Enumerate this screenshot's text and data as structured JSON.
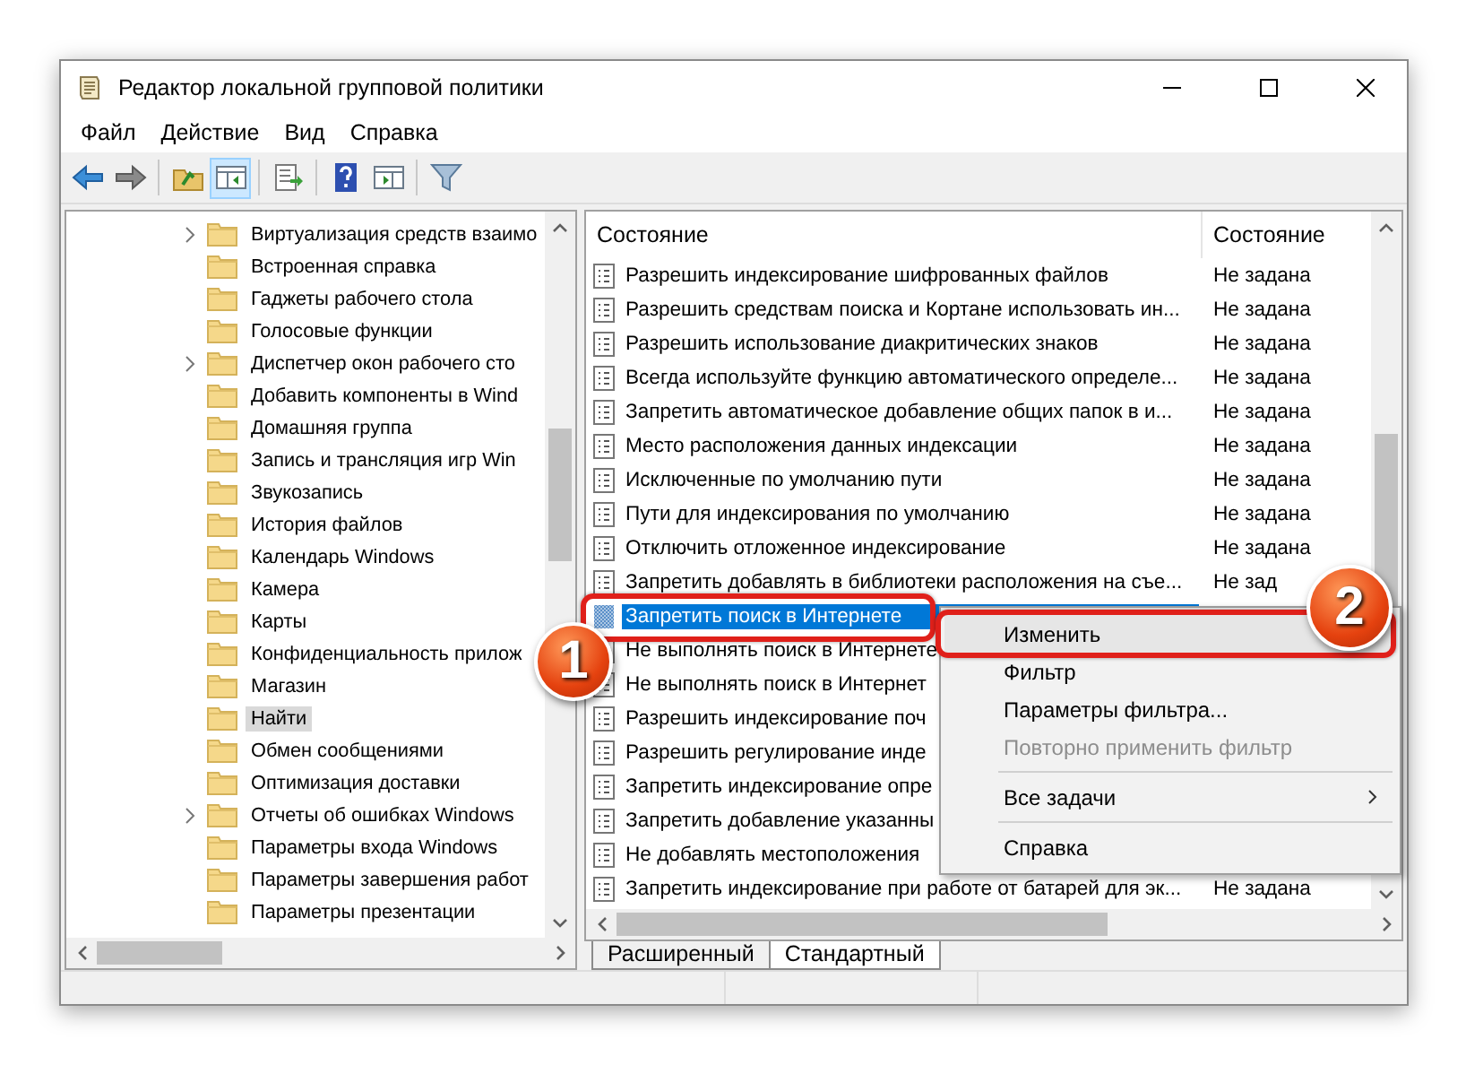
{
  "window": {
    "title": "Редактор локальной групповой политики"
  },
  "menu": [
    "Файл",
    "Действие",
    "Вид",
    "Справка"
  ],
  "toolbar": [
    {
      "kind": "back",
      "pressed": false
    },
    {
      "kind": "forward",
      "pressed": false
    },
    {
      "kind": "sep"
    },
    {
      "kind": "up",
      "pressed": false
    },
    {
      "kind": "tree",
      "pressed": true
    },
    {
      "kind": "sep"
    },
    {
      "kind": "export",
      "pressed": false
    },
    {
      "kind": "sep"
    },
    {
      "kind": "help",
      "pressed": false
    },
    {
      "kind": "pane",
      "pressed": false
    },
    {
      "kind": "sep"
    },
    {
      "kind": "filter",
      "pressed": false
    }
  ],
  "tree": {
    "items": [
      {
        "label": "Виртуализация средств взаимо",
        "expandable": true,
        "selected": false
      },
      {
        "label": "Встроенная справка",
        "expandable": false,
        "selected": false
      },
      {
        "label": "Гаджеты рабочего стола",
        "expandable": false,
        "selected": false
      },
      {
        "label": "Голосовые функции",
        "expandable": false,
        "selected": false
      },
      {
        "label": "Диспетчер окон рабочего сто",
        "expandable": true,
        "selected": false
      },
      {
        "label": "Добавить компоненты в Wind",
        "expandable": false,
        "selected": false
      },
      {
        "label": "Домашняя группа",
        "expandable": false,
        "selected": false
      },
      {
        "label": "Запись и трансляция игр Win",
        "expandable": false,
        "selected": false
      },
      {
        "label": "Звукозапись",
        "expandable": false,
        "selected": false
      },
      {
        "label": "История файлов",
        "expandable": false,
        "selected": false
      },
      {
        "label": "Календарь Windows",
        "expandable": false,
        "selected": false
      },
      {
        "label": "Камера",
        "expandable": false,
        "selected": false
      },
      {
        "label": "Карты",
        "expandable": false,
        "selected": false
      },
      {
        "label": "Конфиденциальность прилож",
        "expandable": false,
        "selected": false
      },
      {
        "label": "Магазин",
        "expandable": false,
        "selected": false
      },
      {
        "label": "Найти",
        "expandable": false,
        "selected": true
      },
      {
        "label": "Обмен сообщениями",
        "expandable": false,
        "selected": false
      },
      {
        "label": "Оптимизация доставки",
        "expandable": false,
        "selected": false
      },
      {
        "label": "Отчеты об ошибках Windows",
        "expandable": true,
        "selected": false
      },
      {
        "label": "Параметры входа Windows",
        "expandable": false,
        "selected": false
      },
      {
        "label": "Параметры завершения работ",
        "expandable": false,
        "selected": false
      },
      {
        "label": "Параметры презентации",
        "expandable": false,
        "selected": false
      }
    ]
  },
  "table": {
    "columns": [
      "Состояние",
      "Состояние"
    ],
    "rows": [
      {
        "name": "Разрешить индексирование шифрованных файлов",
        "status": "Не задана",
        "selected": false
      },
      {
        "name": "Разрешить средствам поиска и Кортане использовать ин...",
        "status": "Не задана",
        "selected": false
      },
      {
        "name": "Разрешить использование диакритических знаков",
        "status": "Не задана",
        "selected": false
      },
      {
        "name": "Всегда используйте функцию автоматического определе...",
        "status": "Не задана",
        "selected": false
      },
      {
        "name": "Запретить автоматическое добавление общих папок в и...",
        "status": "Не задана",
        "selected": false
      },
      {
        "name": "Место расположения данных индексации",
        "status": "Не задана",
        "selected": false
      },
      {
        "name": "Исключенные по умолчанию пути",
        "status": "Не задана",
        "selected": false
      },
      {
        "name": "Пути для индексирования по умолчанию",
        "status": "Не задана",
        "selected": false
      },
      {
        "name": "Отключить отложенное индексирование",
        "status": "Не задана",
        "selected": false
      },
      {
        "name": "Запретить добавлять в библиотеки расположения на съе...",
        "status": "Не зад",
        "selected": false
      },
      {
        "name": "Запретить поиск в Интернете",
        "selected": true
      },
      {
        "name": "Не выполнять поиск в Интернете",
        "selected": false
      },
      {
        "name": "Не выполнять поиск в Интернет",
        "selected": false
      },
      {
        "name": "Разрешить индексирование поч",
        "selected": false
      },
      {
        "name": "Разрешить регулирование инде",
        "selected": false
      },
      {
        "name": "Запретить индексирование опре",
        "selected": false
      },
      {
        "name": "Запретить добавление указанны",
        "selected": false
      },
      {
        "name": "Не добавлять местоположения",
        "selected": false
      },
      {
        "name": "Запретить индексирование при работе от батарей для эк...",
        "status": "Не задана",
        "selected": false
      }
    ]
  },
  "view_tabs": [
    {
      "label": "Расширенный",
      "selected": false
    },
    {
      "label": "Стандартный",
      "selected": true
    }
  ],
  "context_menu": {
    "items": [
      {
        "kind": "item",
        "label": "Изменить",
        "selected": true,
        "disabled": false
      },
      {
        "kind": "item",
        "label": "Фильтр",
        "selected": false,
        "disabled": false
      },
      {
        "kind": "item",
        "label": "Параметры фильтра...",
        "selected": false,
        "disabled": false
      },
      {
        "kind": "item",
        "label": "Повторно применить фильтр",
        "selected": false,
        "disabled": true
      },
      {
        "kind": "separator"
      },
      {
        "kind": "submenu",
        "label": "Все задачи",
        "selected": false,
        "disabled": false
      },
      {
        "kind": "separator"
      },
      {
        "kind": "item",
        "label": "Справка",
        "selected": false,
        "disabled": false
      }
    ]
  },
  "callouts": [
    {
      "number": "1"
    },
    {
      "number": "2"
    }
  ]
}
